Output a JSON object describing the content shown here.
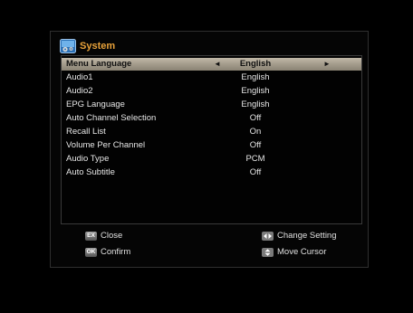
{
  "title": "System",
  "menu": [
    {
      "label": "Menu Language",
      "value": "English",
      "selected": true
    },
    {
      "label": "Audio1",
      "value": "English"
    },
    {
      "label": "Audio2",
      "value": "English"
    },
    {
      "label": "EPG Language",
      "value": "English"
    },
    {
      "label": "Auto Channel Selection",
      "value": "Off"
    },
    {
      "label": "Recall List",
      "value": "On"
    },
    {
      "label": "Volume Per Channel",
      "value": "Off"
    },
    {
      "label": "Audio Type",
      "value": "PCM"
    },
    {
      "label": "Auto Subtitle",
      "value": "Off"
    }
  ],
  "arrows": {
    "left": "◄",
    "right": "►"
  },
  "footer": {
    "close_key": "EX",
    "close_label": "Close",
    "confirm_key": "OK",
    "confirm_label": "Confirm",
    "change_label": "Change Setting",
    "move_label": "Move Cursor"
  },
  "colors": {
    "title": "#e8a23a",
    "selected_bg": "#a49c8c"
  }
}
